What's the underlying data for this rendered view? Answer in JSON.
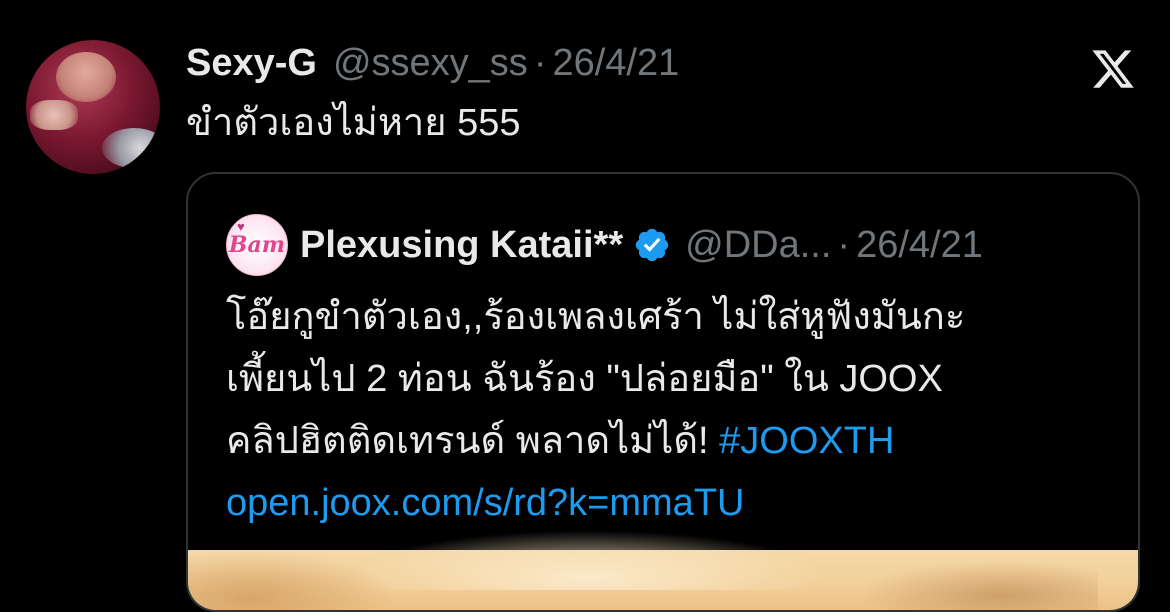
{
  "tweet": {
    "author_name": "Sexy-G",
    "author_handle": "@ssexy_ss",
    "separator": "·",
    "date": "26/4/21",
    "text": "ขำตัวเองไม่หาย 555",
    "avatar_icon": "profile-photo"
  },
  "platform": {
    "logo_icon": "x-logo-icon"
  },
  "quote": {
    "author_name": "Plexusing Kataii**",
    "author_handle": "@DDa...",
    "separator": "·",
    "date": "26/4/21",
    "verified_icon": "verified-badge-icon",
    "avatar_text": "Bam",
    "lines": [
      "โอ๊ยกูขำตัวเอง,,ร้องเพลงเศร้า ไม่ใส่หูฟังมันกะ",
      "เพี้ยนไป 2 ท่อน ฉันร้อง \"ปล่อยมือ\" ใน JOOX"
    ],
    "line3_text": "คลิปฮิตติดเทรนด์ พลาดไม่ได้! ",
    "hashtag": "#JOOXTH",
    "url": "open.joox.com/s/rd?k=mmaTU",
    "media_icon": "media-thumbnail"
  },
  "colors": {
    "background": "#000000",
    "primary_text": "#e7e9ea",
    "secondary_text": "#71767b",
    "link": "#1d9bf0",
    "border": "#2f3336",
    "verified": "#1d9bf0"
  }
}
